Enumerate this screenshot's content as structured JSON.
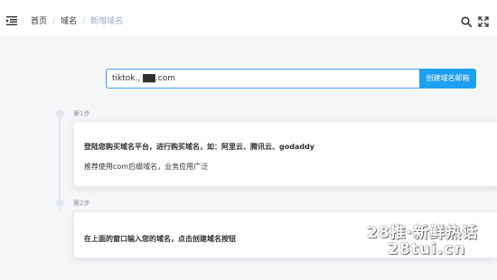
{
  "breadcrumb": {
    "items": [
      "首页",
      "域名",
      "新增域名"
    ],
    "separator": "/"
  },
  "header": {
    "menu_icon": "menu-fold-icon",
    "search_icon": "search-icon",
    "fullscreen_icon": "fullscreen-icon"
  },
  "domain_form": {
    "input_value": "tiktok., ▇▇.com",
    "button_label": "创建域名邮箱"
  },
  "steps": [
    {
      "label": "第1步",
      "title": "登陆您购买域名平台，进行购买域名，如：阿里云、腾讯云、godaddy",
      "description": "推荐使用com后缀域名，业务应用广泛"
    },
    {
      "label": "第2步",
      "title": "在上面的窗口输入您的域名，点击创建域名按钮"
    }
  ],
  "watermark": {
    "line1": "28推·新鲜热话",
    "line2": "28tui.cn"
  },
  "colors": {
    "accent": "#409eff",
    "button": "#1ea0f0",
    "breadcrumb_current": "#97a8be",
    "timeline": "#e4e7ed"
  }
}
